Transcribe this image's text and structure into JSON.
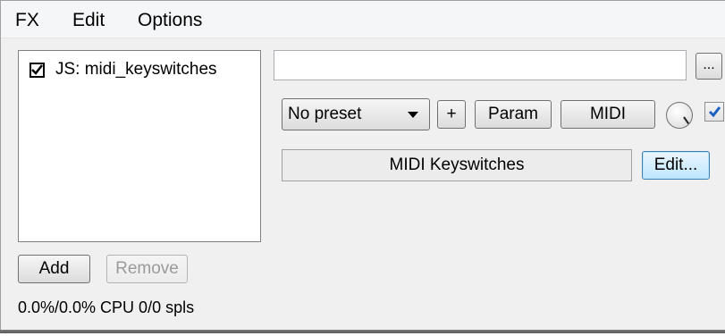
{
  "menu": {
    "items": [
      {
        "label": "FX"
      },
      {
        "label": "Edit"
      },
      {
        "label": "Options"
      }
    ]
  },
  "fx_chain": {
    "items": [
      {
        "label": "JS: midi_keyswitches",
        "enabled": true
      }
    ],
    "add_label": "Add",
    "remove_label": "Remove",
    "cpu_status": "0.0%/0.0% CPU 0/0 spls"
  },
  "plugin": {
    "name_value": "",
    "browse_label": "...",
    "preset": {
      "selected": "No preset"
    },
    "add_preset_label": "+",
    "param_label": "Param",
    "midi_label": "MIDI",
    "enabled": true,
    "jsfx_title": "MIDI Keyswitches",
    "edit_label": "Edit..."
  },
  "colors": {
    "window_bg": "#f0f0f0",
    "checkbox_blue": "#1d62c2",
    "focus_border": "#3c7fb1"
  },
  "icons": {
    "knob": "wet-dry-knob-icon",
    "checkmark": "checkmark-icon",
    "dropdown": "chevron-down-icon"
  }
}
